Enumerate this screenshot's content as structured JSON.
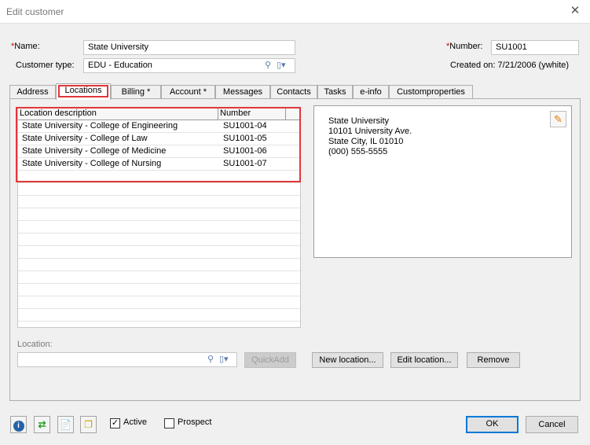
{
  "window": {
    "title": "Edit customer",
    "close_glyph": "✕"
  },
  "form": {
    "name_label": "Name:",
    "name_value": "State University",
    "type_label": "Customer type:",
    "type_value": "EDU - Education",
    "number_label": "Number:",
    "number_value": "SU1001",
    "created_label": "Created on:",
    "created_value": "7/21/2006 (ywhite)",
    "required_marker": "*"
  },
  "tabs": [
    "Address",
    "Locations",
    "Billing  *",
    "Account *",
    "Messages",
    "Contacts",
    "Tasks",
    "e-info",
    "Customproperties"
  ],
  "active_tab": "Locations",
  "locations_grid": {
    "columns": [
      "Location description",
      "Number"
    ],
    "rows": [
      {
        "description": "State University - College of Engineering",
        "number": "SU1001-04"
      },
      {
        "description": "State University - College of Law",
        "number": "SU1001-05"
      },
      {
        "description": "State University - College of Medicine",
        "number": "SU1001-06"
      },
      {
        "description": "State University - College of Nursing",
        "number": "SU1001-07"
      }
    ]
  },
  "address_preview": {
    "line1": "State University",
    "line2": "10101 University Ave.",
    "line3": "State City, IL 01010",
    "line4": "(000) 555-5555"
  },
  "location_section": {
    "label": "Location:",
    "value": "",
    "quickadd_label": "QuickAdd"
  },
  "actions": {
    "new_location": "New location...",
    "edit_location": "Edit location...",
    "remove": "Remove"
  },
  "footer": {
    "active_label": "Active",
    "active_checked": true,
    "prospect_label": "Prospect",
    "prospect_checked": false,
    "ok_label": "OK",
    "cancel_label": "Cancel",
    "check_glyph": "✓"
  },
  "colors": {
    "highlight_red": "#e0383b",
    "ok_border": "#0078d7"
  }
}
